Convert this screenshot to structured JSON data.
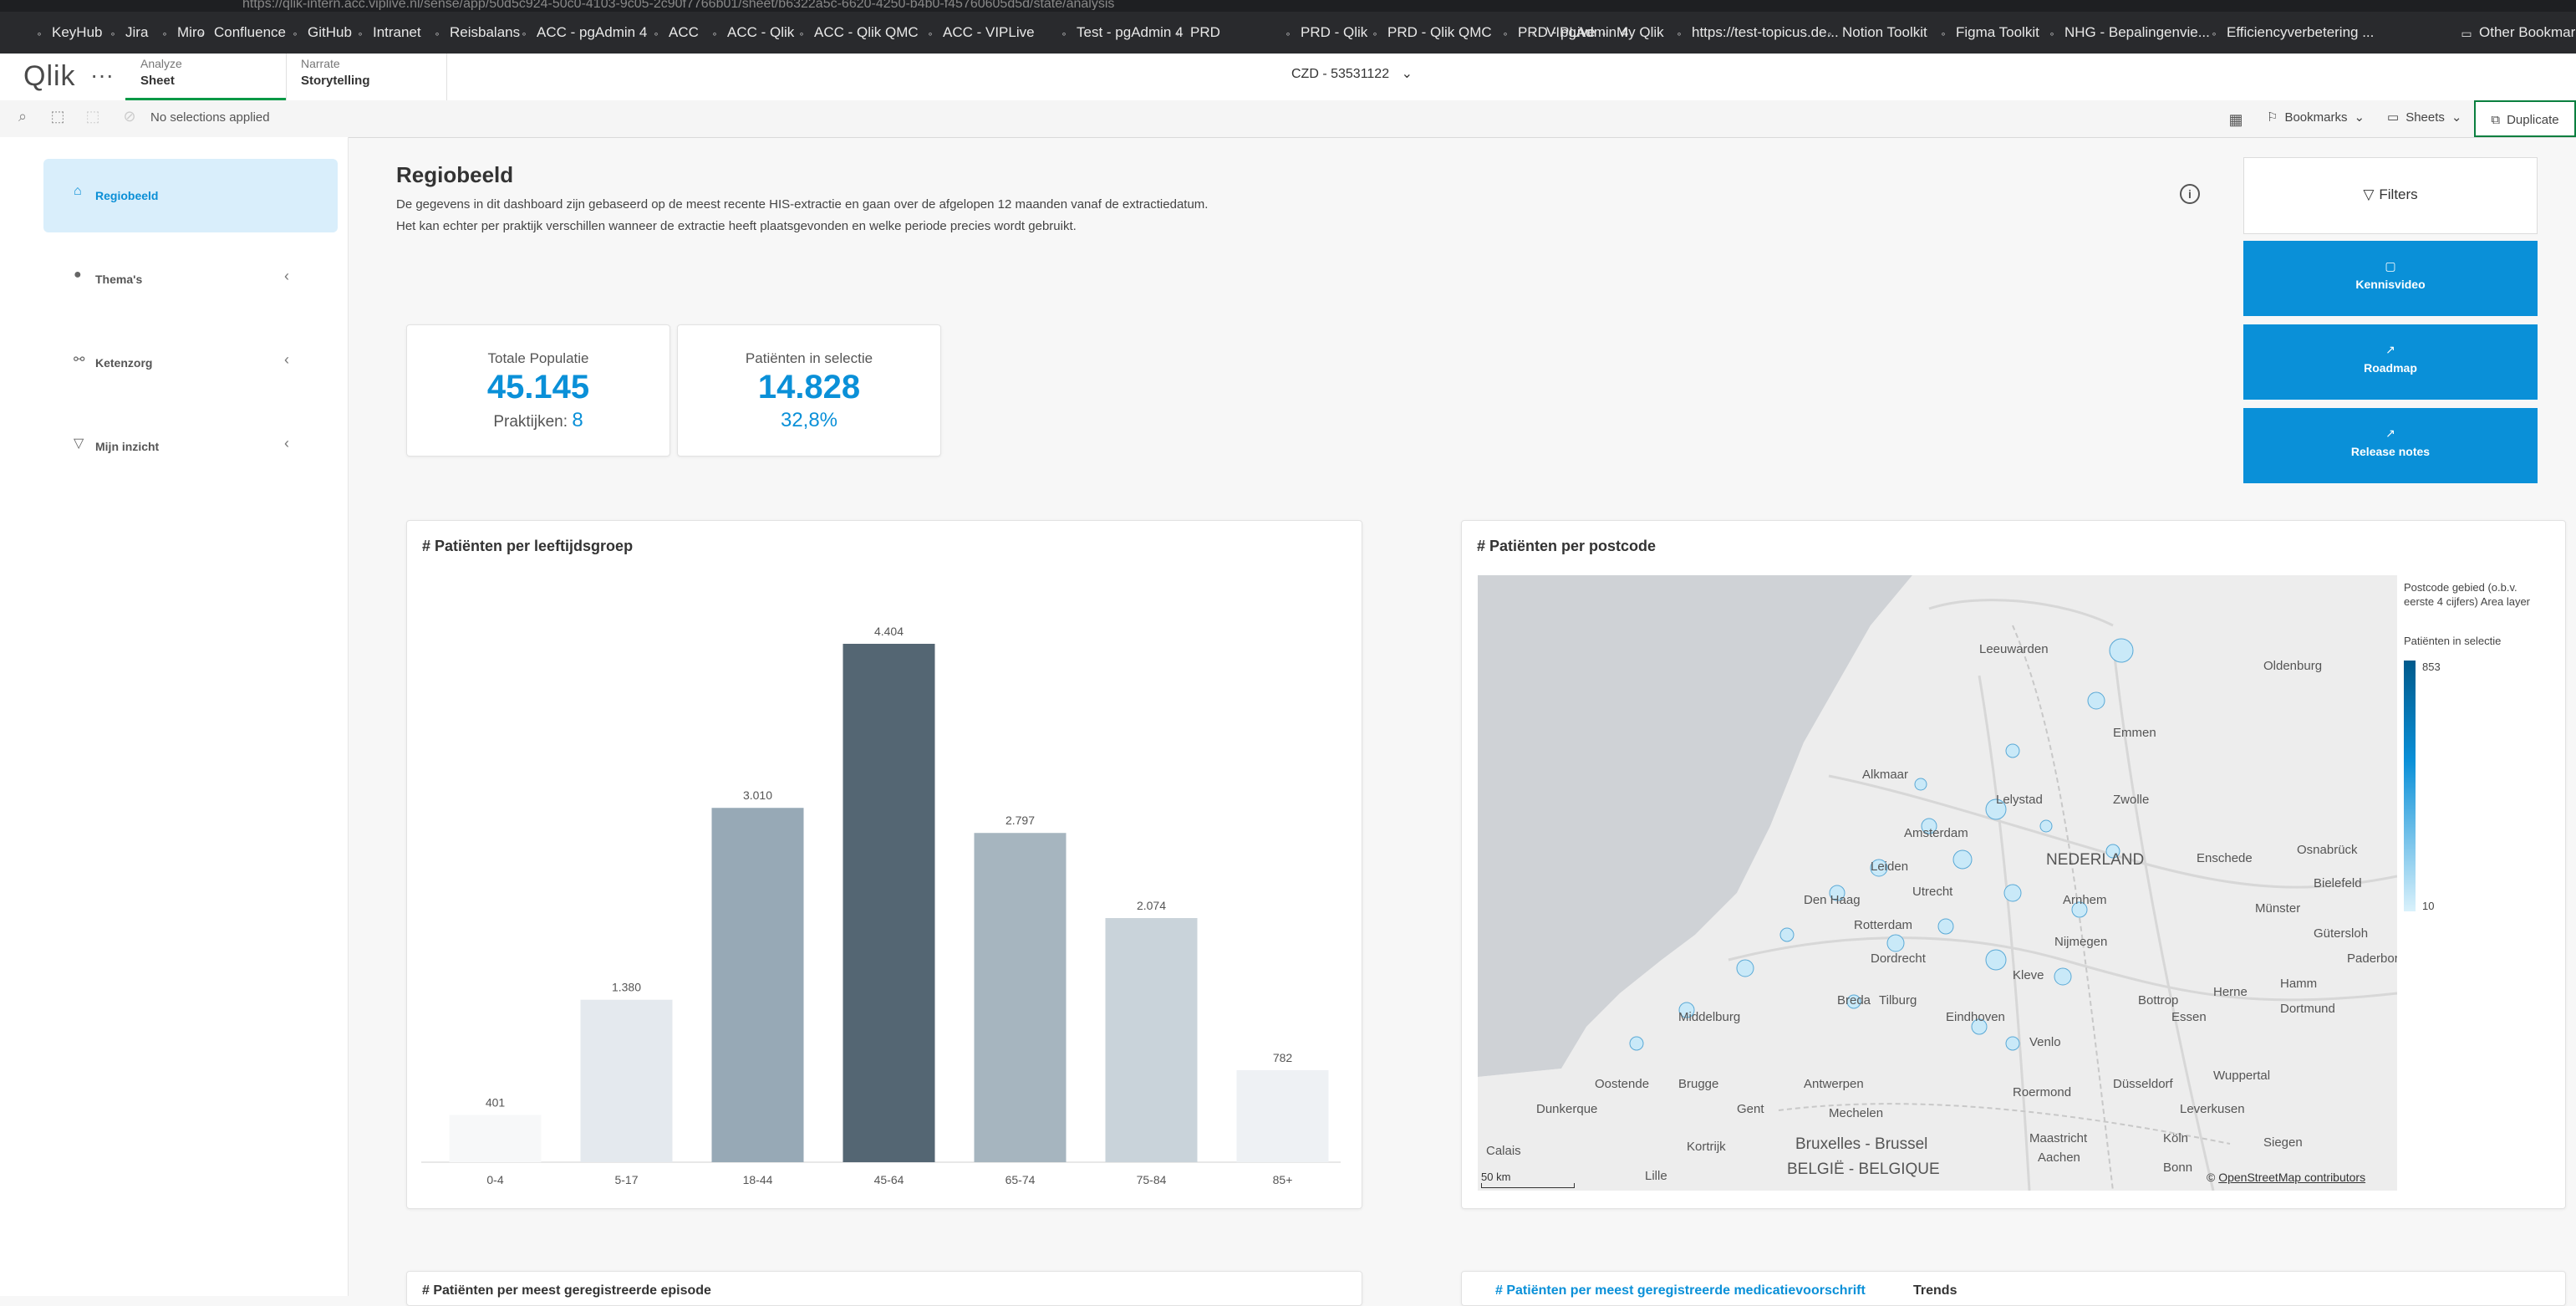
{
  "browser": {
    "url": "https://qlik-intern.acc.viplive.nl/sense/app/50d5c924-50c0-4103-9c05-2c90f7766b01/sheet/b6322a5c-6620-4250-b4b0-f45760605d5d/state/analysis",
    "bookmarks": [
      "KeyHub",
      "Jira",
      "Miro",
      "Confluence",
      "GitHub",
      "Intranet",
      "Reisbalans",
      "ACC - pgAdmin 4",
      "ACC",
      "ACC - Qlik",
      "ACC - Qlik QMC",
      "ACC - VIPLive",
      "Test - pgAdmin 4",
      "PRD",
      "PRD - Qlik",
      "PRD - Qlik QMC",
      "PRD - pgAdmin 4",
      "VIPLive",
      "My Qlik",
      "https://test-topicus.de...",
      "Notion Toolkit",
      "Figma Toolkit",
      "NHG - Bepalingenvie...",
      "Efficiencyverbetering ..."
    ],
    "other_bookmarks": "Other Bookmarks"
  },
  "header": {
    "logo": "Qlik",
    "more": "···",
    "tab_analyze_small": "Analyze",
    "tab_analyze_big": "Sheet",
    "tab_narrate_small": "Narrate",
    "tab_narrate_big": "Storytelling",
    "app_title": "CZD - 53531122"
  },
  "toolbar": {
    "no_selections": "No selections applied",
    "bookmarks": "Bookmarks",
    "sheets": "Sheets",
    "duplicate": "Duplicate"
  },
  "sidebar": {
    "items": [
      {
        "label": "Regiobeeld"
      },
      {
        "label": "Thema's"
      },
      {
        "label": "Ketenzorg"
      },
      {
        "label": "Mijn inzicht"
      }
    ]
  },
  "main": {
    "title": "Regiobeeld",
    "desc1": "De gegevens in dit dashboard zijn gebaseerd op de meest recente HIS-extractie en gaan over de afgelopen 12 maanden vanaf de extractiedatum.",
    "desc2": "Het kan echter per praktijk verschillen wanneer de extractie heeft plaatsgevonden en welke periode precies wordt gebruikt."
  },
  "buttons": {
    "filters": "Filters",
    "kennisvideo": "Kennisvideo",
    "roadmap": "Roadmap",
    "release_notes": "Release notes"
  },
  "kpi": {
    "pop_label": "Totale Populatie",
    "pop_value": "45.145",
    "pop_sub_label": "Praktijken:",
    "pop_sub_value": "8",
    "sel_label": "Patiënten in selectie",
    "sel_value": "14.828",
    "sel_sub": "32,8%"
  },
  "chart_data": {
    "type": "bar",
    "title": "# Patiënten per leeftijdsgroep",
    "categories": [
      "0-4",
      "5-17",
      "18-44",
      "45-64",
      "65-74",
      "75-84",
      "85+"
    ],
    "values": [
      401,
      1380,
      3010,
      4404,
      2797,
      2074,
      782
    ],
    "value_labels": [
      "401",
      "1.380",
      "3.010",
      "4.404",
      "2.797",
      "2.074",
      "782"
    ],
    "colors": [
      "#f7f8f9",
      "#e4e9ee",
      "#97a9b6",
      "#546673",
      "#a6b5bf",
      "#c9d3da",
      "#eef1f4"
    ],
    "xlabel": "",
    "ylabel": "",
    "ylim": [
      0,
      4404
    ],
    "grid": false
  },
  "map": {
    "title": "# Patiënten per postcode",
    "legend_title": "Postcode gebied (o.b.v. eerste 4 cijfers) Area layer",
    "legend_sub": "Patiënten in selectie",
    "legend_max": "853",
    "legend_min": "10",
    "scale": "50 km",
    "attribution_prefix": "©",
    "attribution": "OpenStreetMap contributors",
    "cities": [
      "Leeuwarden",
      "Oldenburg",
      "Emmen",
      "Alkmaar",
      "Lelystad",
      "Zwolle",
      "Amsterdam",
      "Leiden",
      "NEDERLAND",
      "Enschede",
      "Osnabrück",
      "Den Haag",
      "Utrecht",
      "Arnhem",
      "Münster",
      "Bielefeld",
      "Rotterdam",
      "Nijmegen",
      "Gütersloh",
      "Dordrecht",
      "Kleve",
      "Breda",
      "Tilburg",
      "Bottrop",
      "Hamm",
      "Middelburg",
      "Eindhoven",
      "Essen",
      "Dortmund",
      "Venlo",
      "Oostende",
      "Brugge",
      "Antwerpen",
      "Roermond",
      "Düsseldorf",
      "Wuppertal",
      "Dunkerque",
      "Gent",
      "Mechelen",
      "Leverkusen",
      "Calais",
      "Kortrijk",
      "Bruxelles - Brussel",
      "Maastricht",
      "Köln",
      "Siegen",
      "Lille",
      "BELGIË - BELGIQUE",
      "Aachen",
      "Bonn",
      "Paderborn",
      "Herne"
    ]
  },
  "bottom": {
    "left_title": "# Patiënten per meest geregistreerde episode",
    "right_title": "# Patiënten per meest geregistreerde medicatievoorschrift",
    "right_tab2": "Trends"
  }
}
